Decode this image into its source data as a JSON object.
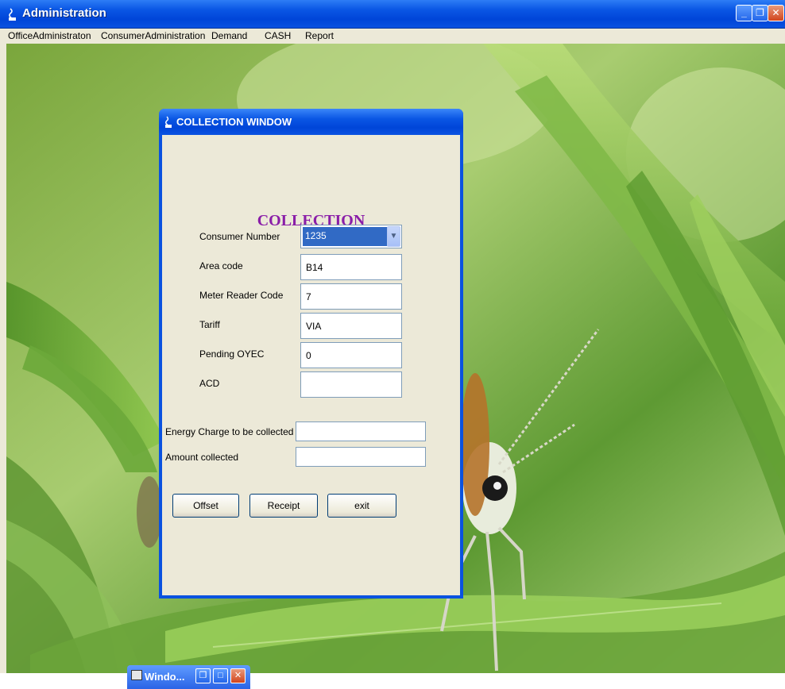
{
  "window": {
    "title": "Administration",
    "minimize_icon": "minimize-icon",
    "restore_icon": "restore-icon",
    "close_icon": "close-icon"
  },
  "menu": {
    "items": [
      "OfficeAdministraton",
      "ConsumerAdministration",
      "Demand",
      "CASH",
      "Report"
    ]
  },
  "dialog": {
    "title": "COLLECTION WINDOW",
    "heading": "COLLECTION",
    "consumer_number_label": "Consumer Number",
    "consumer_number_value": "1235",
    "area_code_label": "Area code",
    "area_code_value": "B14",
    "meter_reader_label": "Meter Reader Code",
    "meter_reader_value": "7",
    "tariff_label": "Tariff",
    "tariff_value": "VIA",
    "pending_label": "Pending OYEC",
    "pending_value": "0",
    "acd_label": "ACD",
    "acd_value": "",
    "energy_charge_label": "Energy Charge to be collected",
    "energy_charge_value": "",
    "amount_collected_label": "Amount  collected",
    "amount_collected_value": "",
    "buttons": {
      "offset": "Offset",
      "receipt": "Receipt",
      "exit": "exit"
    }
  },
  "minimized": {
    "label": "Windo..."
  },
  "colors": {
    "titlebar": "#0a56e4",
    "heading": "#8a1ea8",
    "selection": "#316ac5",
    "dialog_bg": "#ece9d8"
  }
}
